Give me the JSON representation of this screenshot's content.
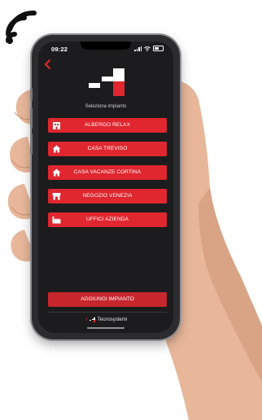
{
  "status_bar": {
    "time": "09:22"
  },
  "header": {
    "subtitle": "Seleziona impianto"
  },
  "plants": [
    {
      "label": "ALBERGO RELAX",
      "icon": "hotel-icon"
    },
    {
      "label": "CASA TREVISO",
      "icon": "home-icon"
    },
    {
      "label": "CASA VACANZE CORTINA",
      "icon": "home-icon"
    },
    {
      "label": "NEGOZIO VENEZIA",
      "icon": "shop-icon"
    },
    {
      "label": "UFFICI AZIENDA",
      "icon": "factory-icon"
    }
  ],
  "actions": {
    "add_plant": "AGGIUNGI IMPIANTO"
  },
  "footer": {
    "brand": "Tecnosystemi"
  },
  "colors": {
    "accent": "#e0262e",
    "screen_bg": "#1c1c1e",
    "text": "#ffffff"
  }
}
